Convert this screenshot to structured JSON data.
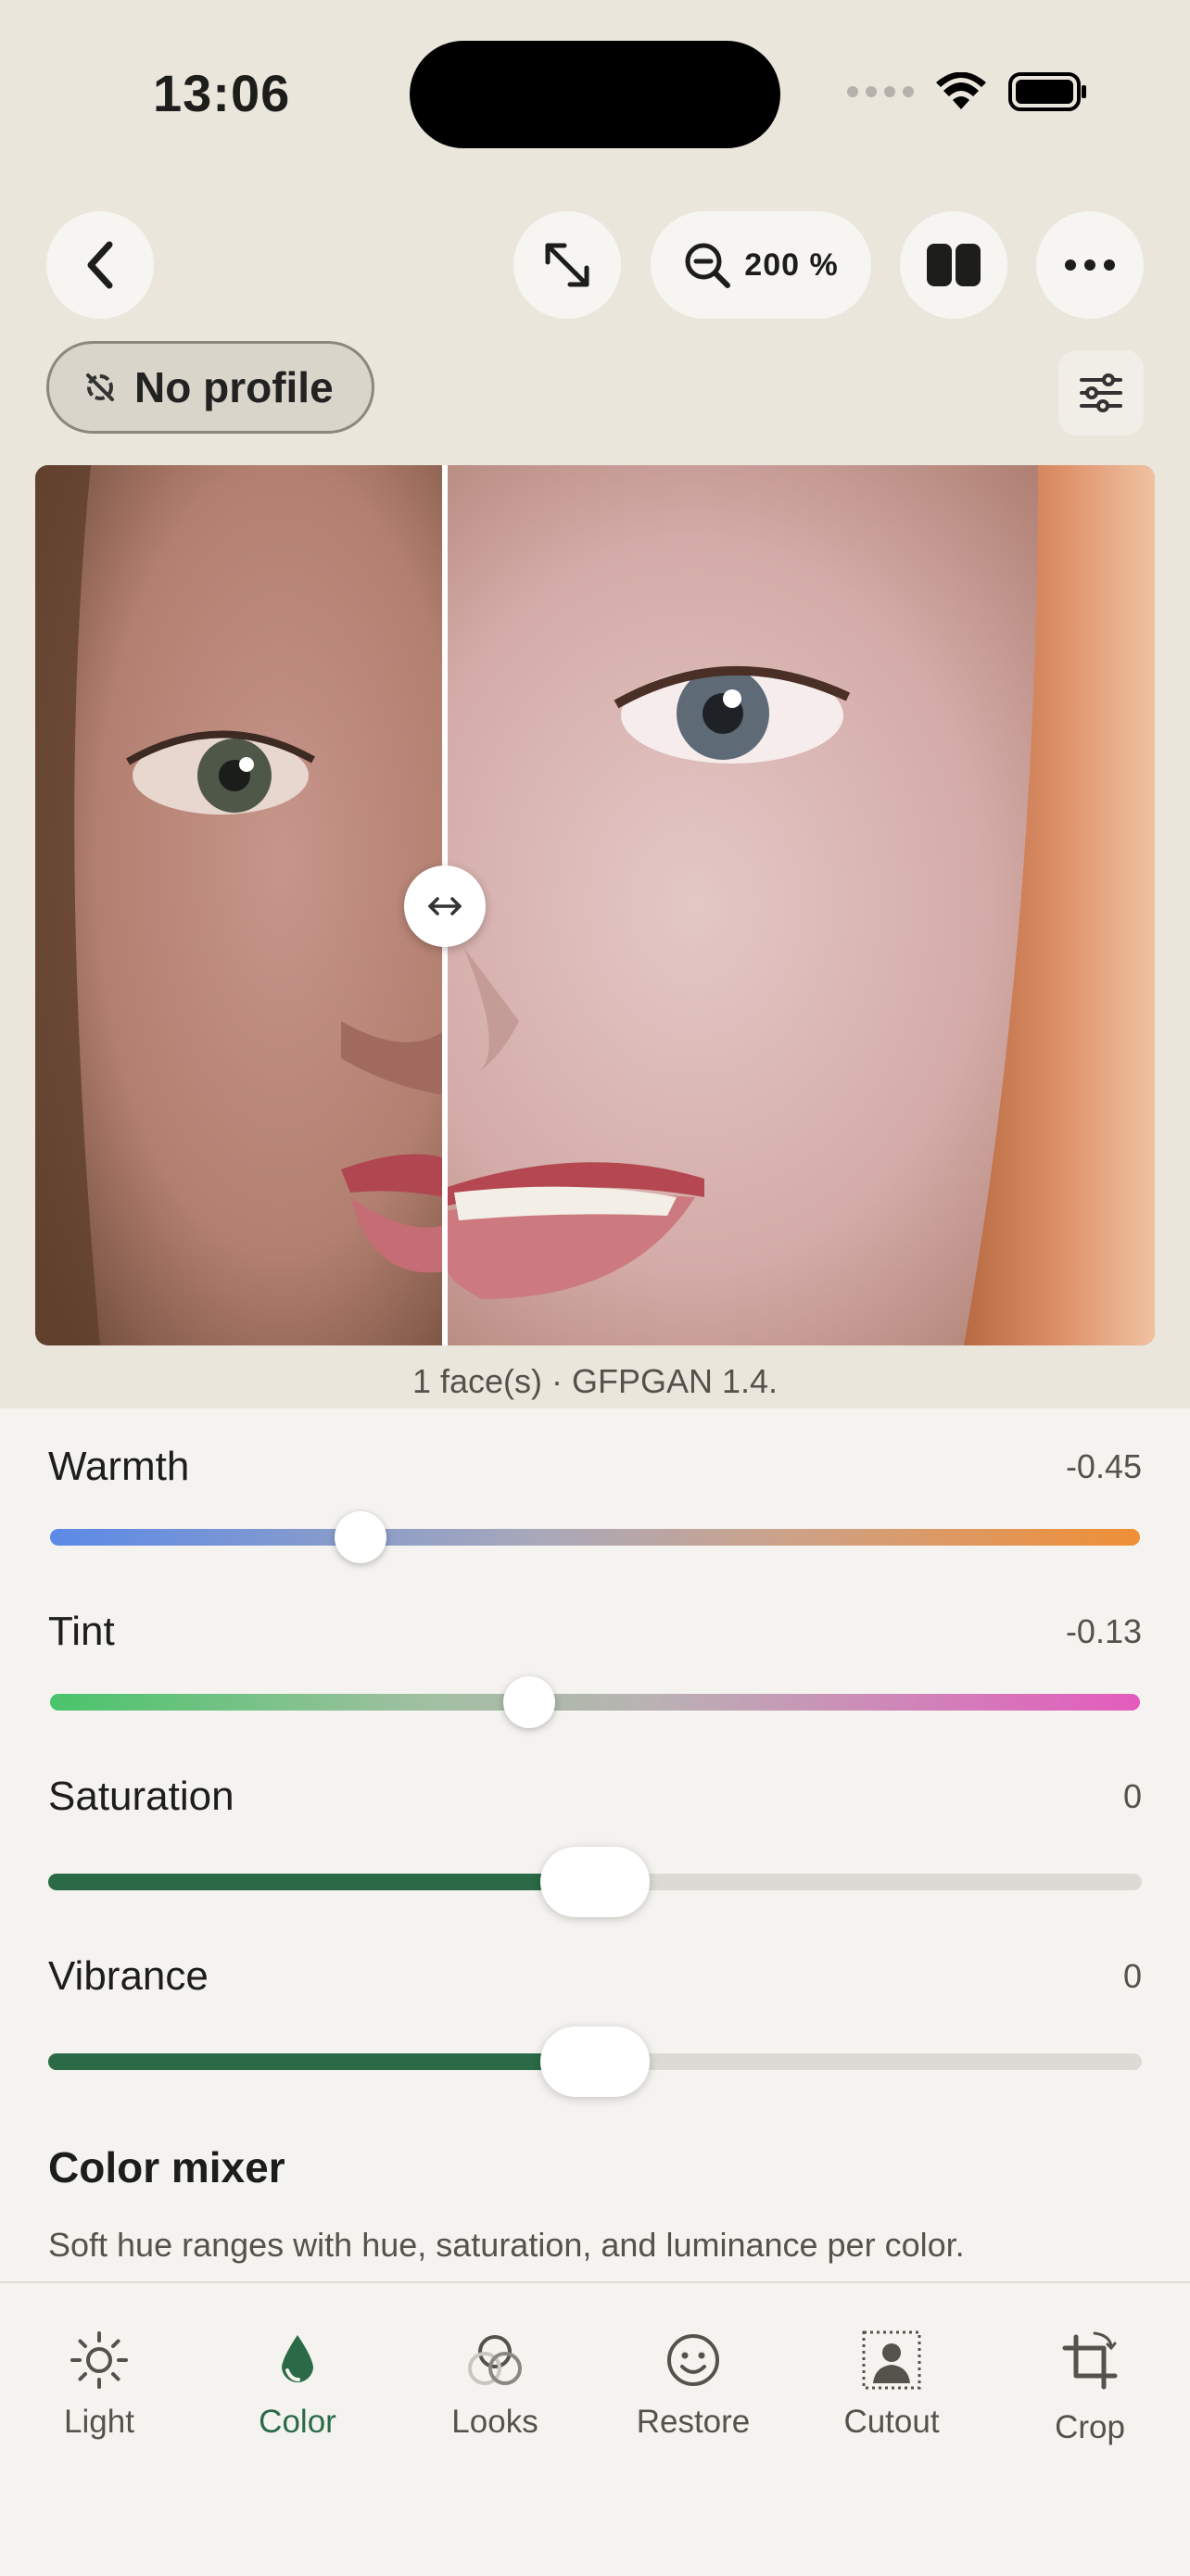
{
  "status": {
    "time": "13:06"
  },
  "toolbar": {
    "zoom_label": "200 %"
  },
  "profile": {
    "label": "No profile"
  },
  "caption": "1 face(s) · GFPGAN 1.4.",
  "sliders": [
    {
      "label": "Warmth",
      "value": "-0.45",
      "position": 0.285
    },
    {
      "label": "Tint",
      "value": "-0.13",
      "position": 0.44
    },
    {
      "label": "Saturation",
      "value": "0",
      "position": 0.5
    },
    {
      "label": "Vibrance",
      "value": "0",
      "position": 0.5
    }
  ],
  "color_mixer": {
    "title": "Color mixer",
    "description": "Soft hue ranges with hue, saturation, and luminance per color."
  },
  "tabs": [
    {
      "label": "Light",
      "icon": "sun-icon"
    },
    {
      "label": "Color",
      "icon": "drop-icon",
      "active": true
    },
    {
      "label": "Looks",
      "icon": "circles-icon"
    },
    {
      "label": "Restore",
      "icon": "smiley-icon"
    },
    {
      "label": "Cutout",
      "icon": "person-cutout-icon"
    },
    {
      "label": "Crop",
      "icon": "crop-icon"
    }
  ],
  "colors": {
    "accent": "#2a6a46",
    "background": "#f5f3ef",
    "top_background": "#ebe6dc"
  }
}
